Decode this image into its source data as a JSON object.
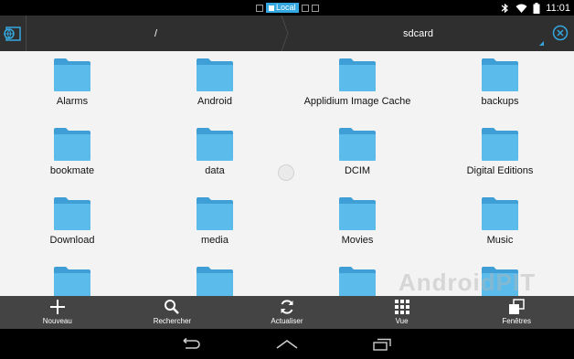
{
  "status_bar": {
    "local_label": "Local",
    "time": "11:01"
  },
  "path_bar": {
    "root_label": "/",
    "current_label": "sdcard"
  },
  "folders": [
    {
      "name": "Alarms"
    },
    {
      "name": "Android"
    },
    {
      "name": "Applidium Image Cache"
    },
    {
      "name": "backups"
    },
    {
      "name": "bookmate"
    },
    {
      "name": "data"
    },
    {
      "name": "DCIM"
    },
    {
      "name": "Digital Editions"
    },
    {
      "name": "Download"
    },
    {
      "name": "media"
    },
    {
      "name": "Movies"
    },
    {
      "name": "Music"
    },
    {
      "name": ""
    },
    {
      "name": ""
    },
    {
      "name": ""
    },
    {
      "name": ""
    }
  ],
  "toolbar": {
    "new_label": "Nouveau",
    "search_label": "Rechercher",
    "refresh_label": "Actualiser",
    "view_label": "Vue",
    "windows_label": "Fenêtres"
  },
  "watermark": "AndroidPIT",
  "colors": {
    "accent": "#35a7e0",
    "folder": "#5bbcec",
    "folder_tab": "#3e9fd6"
  }
}
